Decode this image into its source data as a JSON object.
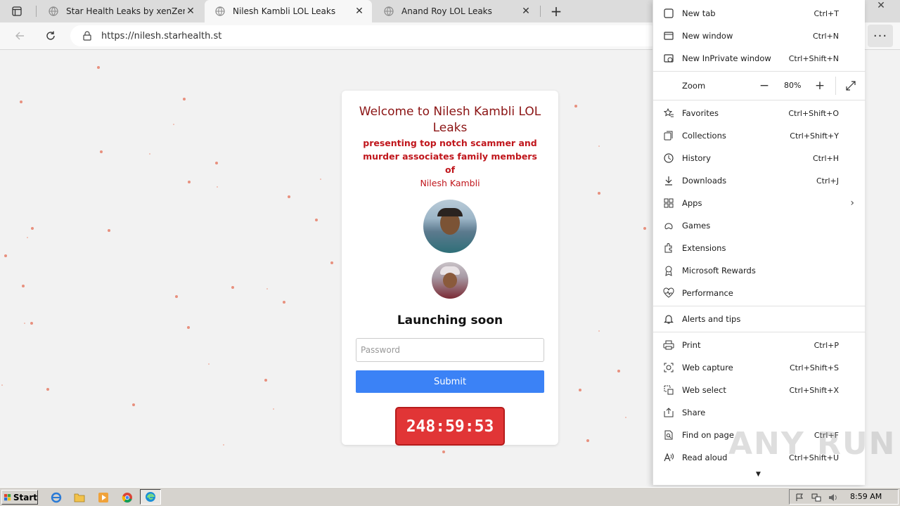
{
  "browser": {
    "tabs": [
      {
        "title": "Star Health Leaks by xenZen",
        "active": false
      },
      {
        "title": "Nilesh Kambli LOL Leaks",
        "active": true
      },
      {
        "title": "Anand Roy LOL Leaks",
        "active": false
      }
    ],
    "url": "https://nilesh.starhealth.st",
    "more_button": "···"
  },
  "page": {
    "heading": "Welcome to Nilesh Kambli LOL Leaks",
    "subtitle": "presenting top notch scammer and murder associates family members of",
    "subtitle_name": "Nilesh Kambli",
    "launch_text": "Launching soon",
    "password_placeholder": "Password",
    "submit_label": "Submit",
    "countdown": "248:59:53"
  },
  "menu": {
    "items_top": [
      {
        "label": "New tab",
        "shortcut": "Ctrl+T",
        "icon": "new-tab-icon"
      },
      {
        "label": "New window",
        "shortcut": "Ctrl+N",
        "icon": "new-window-icon"
      },
      {
        "label": "New InPrivate window",
        "shortcut": "Ctrl+Shift+N",
        "icon": "inprivate-icon"
      }
    ],
    "zoom": {
      "label": "Zoom",
      "value": "80%"
    },
    "items_mid": [
      {
        "label": "Favorites",
        "shortcut": "Ctrl+Shift+O",
        "icon": "favorites-icon"
      },
      {
        "label": "Collections",
        "shortcut": "Ctrl+Shift+Y",
        "icon": "collections-icon"
      },
      {
        "label": "History",
        "shortcut": "Ctrl+H",
        "icon": "history-icon"
      },
      {
        "label": "Downloads",
        "shortcut": "Ctrl+J",
        "icon": "downloads-icon"
      },
      {
        "label": "Apps",
        "shortcut": "",
        "icon": "apps-icon"
      },
      {
        "label": "Games",
        "shortcut": "",
        "icon": "games-icon"
      },
      {
        "label": "Extensions",
        "shortcut": "",
        "icon": "extensions-icon"
      },
      {
        "label": "Microsoft Rewards",
        "shortcut": "",
        "icon": "rewards-icon"
      },
      {
        "label": "Performance",
        "shortcut": "",
        "icon": "performance-icon"
      }
    ],
    "alerts": {
      "label": "Alerts and tips",
      "icon": "bell-icon"
    },
    "items_bottom": [
      {
        "label": "Print",
        "shortcut": "Ctrl+P",
        "icon": "print-icon"
      },
      {
        "label": "Web capture",
        "shortcut": "Ctrl+Shift+S",
        "icon": "web-capture-icon"
      },
      {
        "label": "Web select",
        "shortcut": "Ctrl+Shift+X",
        "icon": "web-select-icon"
      },
      {
        "label": "Share",
        "shortcut": "",
        "icon": "share-icon"
      },
      {
        "label": "Find on page",
        "shortcut": "Ctrl+F",
        "icon": "find-icon"
      },
      {
        "label": "Read aloud",
        "shortcut": "Ctrl+Shift+U",
        "icon": "read-aloud-icon"
      }
    ]
  },
  "taskbar": {
    "start_label": "Start",
    "clock": "8:59 AM"
  },
  "watermark": "ANY RUN"
}
